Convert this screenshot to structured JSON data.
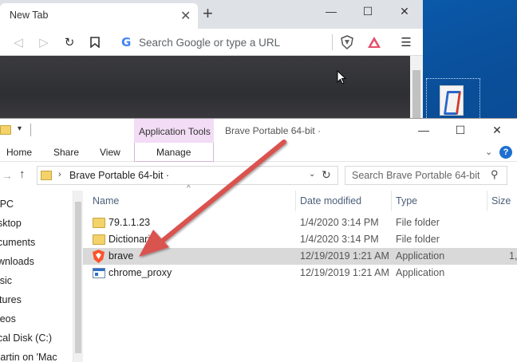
{
  "colors": {
    "desktop": "#0a5aa8",
    "context_tab": "#f3dcf5",
    "selection": "#d9d9d9",
    "annotation_arrow": "#d9534f"
  },
  "browser": {
    "tab_title": "New Tab",
    "omnibox_placeholder": "Search Google or type a URL",
    "icons": [
      "back-icon",
      "forward-icon",
      "reload-icon",
      "bookmark-icon",
      "google-icon",
      "brave-shield-icon",
      "brave-rewards-icon",
      "menu-icon"
    ]
  },
  "explorer": {
    "context_tab": "Application Tools",
    "window_title": "Brave Portable 64-bit",
    "title_sep": "·",
    "ribbon_tabs": [
      "Home",
      "Share",
      "View"
    ],
    "manage_tab": "Manage",
    "help_glyph": "?",
    "address": "Brave Portable 64-bit",
    "search_placeholder": "Search Brave Portable 64-bit",
    "nav_items": [
      "s PC",
      "esktop",
      "ocuments",
      "ownloads",
      "lusic",
      "ictures",
      "ideos",
      "ocal Disk (C:)",
      "martin on 'Mac"
    ],
    "columns": {
      "name": "Name",
      "date": "Date modified",
      "type": "Type",
      "size": "Size"
    },
    "rows": [
      {
        "name": "79.1.1.23",
        "date": "1/4/2020 3:14 PM",
        "type": "File folder",
        "size": "",
        "icon": "folder-icon"
      },
      {
        "name": "Dictionaries",
        "date": "1/4/2020 3:14 PM",
        "type": "File folder",
        "size": "",
        "icon": "folder-icon"
      },
      {
        "name": "brave",
        "date": "12/19/2019 1:21 AM",
        "type": "Application",
        "size": "1,",
        "icon": "brave-icon"
      },
      {
        "name": "chrome_proxy",
        "date": "12/19/2019 1:21 AM",
        "type": "Application",
        "size": "",
        "icon": "application-icon"
      }
    ]
  }
}
